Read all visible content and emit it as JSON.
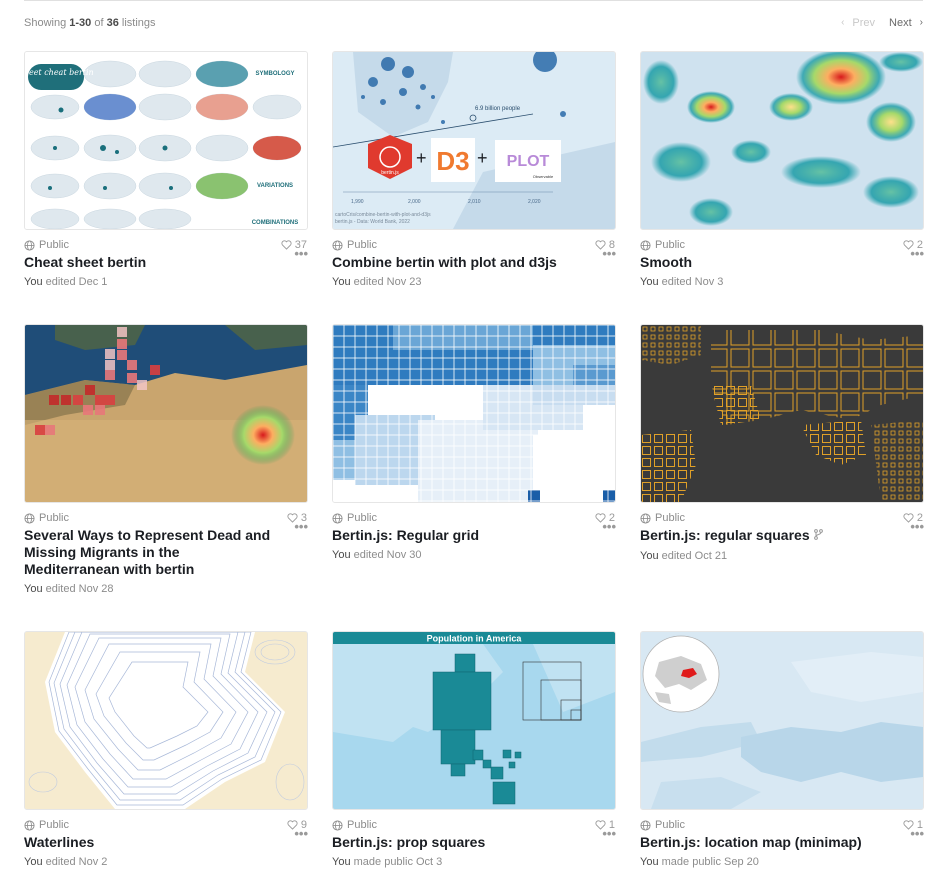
{
  "header": {
    "showing_prefix": "Showing",
    "range": "1-30",
    "of_word": "of",
    "total": "36",
    "listings_word": "listings",
    "prev_label": "Prev",
    "next_label": "Next"
  },
  "cards": [
    {
      "visibility": "Public",
      "likes": "37",
      "title": "Cheat sheet bertin",
      "who": "You",
      "action": "edited Dec 1",
      "thumb_text": {
        "badge": "Sheet cheat bertin",
        "symbology": "SYMBOLOGY",
        "variations": "VARIATIONS",
        "combinations": "COMBINATIONS"
      }
    },
    {
      "visibility": "Public",
      "likes": "8",
      "title": "Combine bertin with plot and d3js",
      "who": "You",
      "action": "edited Nov 23",
      "thumb_text": {
        "annotation": "6.9 billion people",
        "ticks": [
          "1,990",
          "2,000",
          "2,010",
          "2,020"
        ],
        "logo_bertin": "bertin.js",
        "logo_d3": "D3",
        "logo_plot": "PLOT",
        "observable": "Observable",
        "source1": "cartoCris/combine-bertin-with-plot-and-d3js",
        "source2": "bertin.js - Data: World Bank, 2022"
      }
    },
    {
      "visibility": "Public",
      "likes": "2",
      "title": "Smooth",
      "who": "You",
      "action": "edited Nov 3"
    },
    {
      "visibility": "Public",
      "likes": "3",
      "title": "Several Ways to Represent Dead and Missing Migrants in the Mediterranean with bertin",
      "who": "You",
      "action": "edited Nov 28"
    },
    {
      "visibility": "Public",
      "likes": "2",
      "title": "Bertin.js: Regular grid",
      "who": "You",
      "action": "edited Nov 30"
    },
    {
      "visibility": "Public",
      "likes": "2",
      "title": "Bertin.js: regular squares",
      "who": "You",
      "action": "edited Oct 21",
      "forked": true
    },
    {
      "visibility": "Public",
      "likes": "9",
      "title": "Waterlines",
      "who": "You",
      "action": "edited Nov 2"
    },
    {
      "visibility": "Public",
      "likes": "1",
      "title": "Bertin.js: prop squares",
      "who": "You",
      "action": "made public Oct 3",
      "thumb_text": {
        "banner": "Population in America"
      }
    },
    {
      "visibility": "Public",
      "likes": "1",
      "title": "Bertin.js: location map (minimap)",
      "who": "You",
      "action": "made public Sep 20"
    }
  ],
  "colors": {
    "accent_teal": "#1a8a96",
    "heat_red": "#d7191c",
    "ocean": "#dcebf5"
  },
  "icons": {
    "globe": "globe-icon",
    "heart": "heart-icon",
    "more": "more-dots-icon",
    "fork": "fork-icon",
    "prev": "chevron-left-icon",
    "next": "chevron-right-icon"
  }
}
